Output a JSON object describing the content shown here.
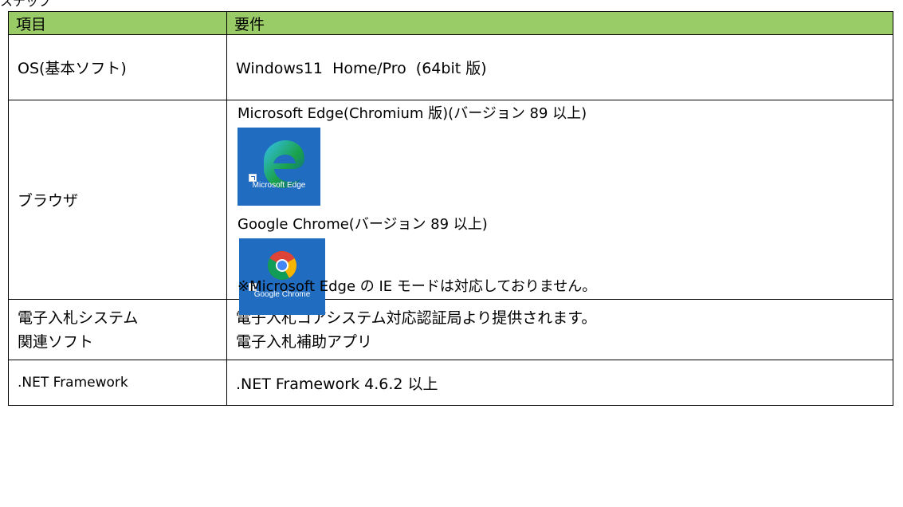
{
  "section_label": "ステップ",
  "table": {
    "header": {
      "item": "項目",
      "requirement": "要件"
    },
    "rows": {
      "os": {
        "item": "OS(基本ソフト)",
        "requirement": "Windows11  Home/Pro  (64bit 版)"
      },
      "browser": {
        "item": "ブラウザ",
        "edge_text": "Microsoft Edge(Chromium 版)(バージョン 89 以上)",
        "edge_icon": "microsoft-edge-icon",
        "edge_icon_label": "Microsoft Edge",
        "chrome_text": "Google Chrome(バージョン 89 以上)",
        "chrome_icon": "google-chrome-icon",
        "chrome_icon_label": "Google Chrome",
        "note": "※Microsoft Edge の IE モードは対応しておりません。"
      },
      "system": {
        "item_line1": "電子入札システム",
        "item_line2": "関連ソフト",
        "req_line1": "電子入札コアシステム対応認証局より提供されます。",
        "req_line2": "電子入札補助アプリ"
      },
      "net": {
        "item": ".NET Framework",
        "requirement": ".NET Framework 4.6.2 以上"
      }
    }
  },
  "colors": {
    "header_background": "#99cc66",
    "icon_tile_background": "#1f6cc1",
    "border": "#000000"
  }
}
